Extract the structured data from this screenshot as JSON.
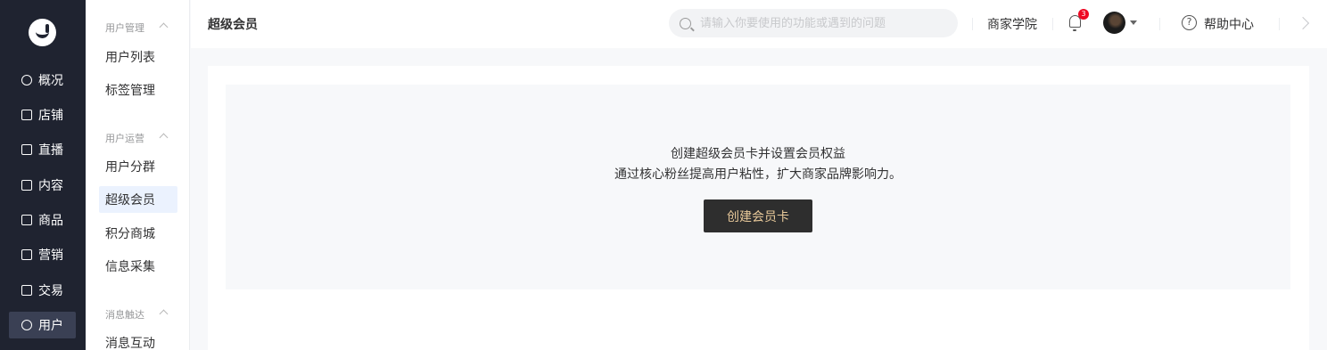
{
  "nav_primary": {
    "items": [
      {
        "label": "概况",
        "icon": "pie-chart-icon"
      },
      {
        "label": "店铺",
        "icon": "store-icon"
      },
      {
        "label": "直播",
        "icon": "live-icon"
      },
      {
        "label": "内容",
        "icon": "document-icon"
      },
      {
        "label": "商品",
        "icon": "product-icon"
      },
      {
        "label": "营销",
        "icon": "megaphone-icon"
      },
      {
        "label": "交易",
        "icon": "transaction-icon"
      },
      {
        "label": "用户",
        "icon": "user-icon",
        "active": true
      }
    ]
  },
  "nav_secondary": {
    "groups": [
      {
        "title": "用户管理",
        "items": [
          "用户列表",
          "标签管理"
        ]
      },
      {
        "title": "用户运营",
        "items": [
          "用户分群",
          "超级会员",
          "积分商城",
          "信息采集"
        ]
      },
      {
        "title": "消息触达",
        "items": [
          "消息互动"
        ]
      }
    ],
    "active_item": "超级会员"
  },
  "header": {
    "title": "超级会员",
    "search_placeholder": "请输入你要使用的功能或遇到的问题",
    "academy_label": "商家学院",
    "notification_count": "3",
    "help_label": "帮助中心"
  },
  "empty_state": {
    "title": "创建超级会员卡并设置会员权益",
    "description": "通过核心粉丝提高用户粘性，扩大商家品牌影响力。",
    "button_label": "创建会员卡"
  },
  "colors": {
    "sidebar_bg": "#1f2330",
    "active_item_bg": "#ebf2fe",
    "button_bg": "#2e2e2e",
    "button_text": "#e8c99a",
    "badge": "#ee0a24"
  }
}
